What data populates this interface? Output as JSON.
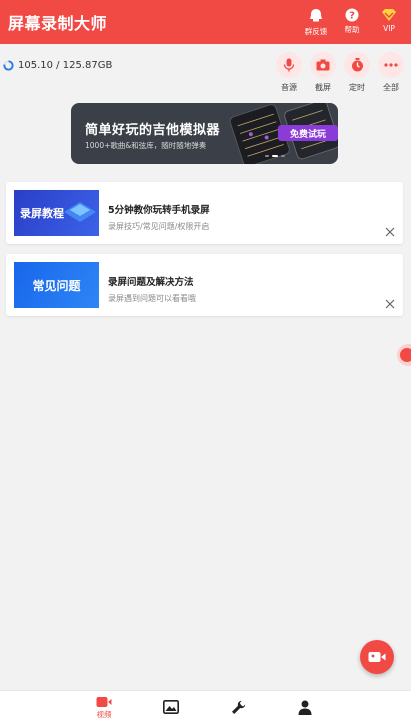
{
  "app": {
    "title": "屏幕录制大师"
  },
  "header_actions": [
    {
      "label": "群反馈",
      "icon": "feedback-icon"
    },
    {
      "label": "帮助",
      "icon": "help-icon"
    },
    {
      "label": "VIP",
      "icon": "vip-diamond-icon"
    }
  ],
  "storage": {
    "text": "105.10 / 125.87GB"
  },
  "tools": [
    {
      "label": "音源",
      "icon": "microphone-icon"
    },
    {
      "label": "截屏",
      "icon": "camera-icon"
    },
    {
      "label": "定时",
      "icon": "timer-icon"
    },
    {
      "label": "全部",
      "icon": "more-icon"
    }
  ],
  "banner": {
    "title": "简单好玩的吉他模拟器",
    "subtitle": "1000+歌曲&和弦库，随时随地弹奏",
    "button": "免费试玩",
    "page_count": 3,
    "active_page": 1
  },
  "cards": [
    {
      "thumb_text": "录屏教程",
      "title": "5分钟教你玩转手机录屏",
      "subtitle": "录屏技巧/常见问题/权限开启",
      "thumb_color": "#2b3fc9"
    },
    {
      "thumb_text": "常见问题",
      "title": "录屏问题及解决方法",
      "subtitle": "录屏遇到问题可以看看哦",
      "thumb_color": "#1e6ff0"
    }
  ],
  "bottom_nav": [
    {
      "label": "视频",
      "icon": "video-icon",
      "active": true
    },
    {
      "label": "",
      "icon": "image-icon",
      "active": false
    },
    {
      "label": "",
      "icon": "wrench-icon",
      "active": false
    },
    {
      "label": "",
      "icon": "person-icon",
      "active": false
    }
  ],
  "colors": {
    "accent": "#f14a45",
    "accent_light": "#fde6e5",
    "background": "#f2f2f2"
  }
}
